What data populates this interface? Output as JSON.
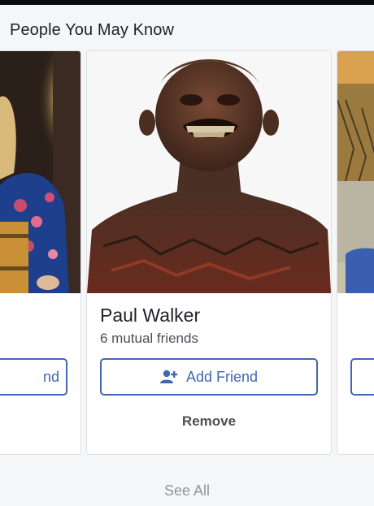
{
  "header": {
    "title": "People You May Know"
  },
  "cards": {
    "left": {
      "button_label": "nd"
    },
    "main": {
      "name": "Paul Walker",
      "mutual": "6 mutual friends",
      "add_label": "Add Friend",
      "remove_label": "Remove"
    }
  },
  "footer": {
    "see_all": "See All"
  },
  "colors": {
    "accent": "#4267b2",
    "background": "#f5f6f7",
    "card": "#ffffff"
  },
  "icons": {
    "add_friend": "add-friend-icon"
  }
}
